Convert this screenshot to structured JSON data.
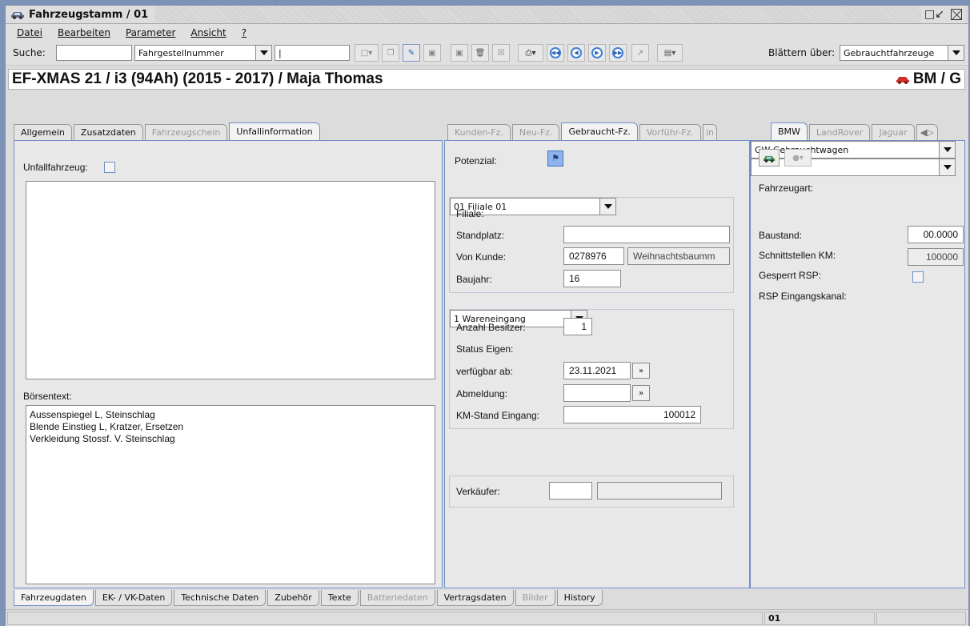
{
  "window": {
    "title": "Fahrzeugstamm / 01"
  },
  "menu": [
    "Datei",
    "Bearbeiten",
    "Parameter",
    "Ansicht",
    "?"
  ],
  "toolbar": {
    "search_label": "Suche:",
    "search_value": "",
    "search_field": "Fahrgestellnummer",
    "search_term": "|",
    "browse_label": "Blättern über:",
    "browse_value": "Gebrauchtfahrzeuge"
  },
  "header": {
    "record": "EF-XMAS 21 / i3 (94Ah) (2015 - 2017) / Maja Thomas",
    "brand_code": "BM / G"
  },
  "left_tabs": [
    {
      "label": "Allgemein",
      "state": "normal"
    },
    {
      "label": "Zusatzdaten",
      "state": "normal"
    },
    {
      "label": "Fahrzeugschein",
      "state": "disabled"
    },
    {
      "label": "Unfallinformation",
      "state": "selected"
    }
  ],
  "mid_tabs": [
    {
      "label": "Kunden-Fz.",
      "state": "disabled"
    },
    {
      "label": "Neu-Fz.",
      "state": "disabled"
    },
    {
      "label": "Gebraucht-Fz.",
      "state": "selected"
    },
    {
      "label": "Vorführ-Fz.",
      "state": "disabled"
    },
    {
      "label": "in",
      "state": "disabled"
    }
  ],
  "right_tabs": [
    {
      "label": "BMW",
      "state": "selected"
    },
    {
      "label": "LandRover",
      "state": "disabled"
    },
    {
      "label": "Jaguar",
      "state": "disabled"
    }
  ],
  "left_panel": {
    "accident_label": "Unfallfahrzeug:",
    "accident_checked": false,
    "exchange_label": "Börsentext:",
    "exchange_lines": [
      "Aussenspiegel L, Steinschlag",
      "Blende Einstieg L, Kratzer, Ersetzen",
      "Verkleidung Stossf. V. Steinschlag"
    ]
  },
  "mid_panel": {
    "potenzial_label": "Potenzial:",
    "filiale_label": "Filiale:",
    "filiale_value": "01 Filiale 01",
    "standplatz_label": "Standplatz:",
    "standplatz_value": "",
    "kunde_label": "Von Kunde:",
    "kunde_nr": "0278976",
    "kunde_name": "Weihnachtsbaumm",
    "baujahr_label": "Baujahr:",
    "baujahr_value": "16",
    "besitzer_label": "Anzahl Besitzer:",
    "besitzer_value": "1",
    "status_label": "Status Eigen:",
    "status_value": "1 Wareneingang",
    "verfuegbar_label": "verfügbar ab:",
    "verfuegbar_value": "23.11.2021",
    "abmeldung_label": "Abmeldung:",
    "abmeldung_value": "",
    "km_label": "KM-Stand Eingang:",
    "km_value": "100012",
    "verkaeufer_label": "Verkäufer:",
    "verkaeufer_code": "",
    "verkaeufer_name": ""
  },
  "right_panel": {
    "fahrzeugart_label": "Fahrzeugart:",
    "fahrzeugart_value": "GW Gebrauchtwagen",
    "baustand_label": "Baustand:",
    "baustand_value": "00.0000",
    "km_label": "Schnittstellen KM:",
    "km_value": "100000",
    "rsp_label": "Gesperrt RSP:",
    "kanal_label": "RSP Eingangskanal:",
    "kanal_value": ""
  },
  "bottom_tabs": [
    {
      "label": "Fahrzeugdaten",
      "state": "selected"
    },
    {
      "label": "EK- / VK-Daten",
      "state": "normal"
    },
    {
      "label": "Technische Daten",
      "state": "normal"
    },
    {
      "label": "Zubehör",
      "state": "normal"
    },
    {
      "label": "Texte",
      "state": "normal"
    },
    {
      "label": "Batteriedaten",
      "state": "disabled"
    },
    {
      "label": "Vertragsdaten",
      "state": "normal"
    },
    {
      "label": "Bilder",
      "state": "disabled"
    },
    {
      "label": "History",
      "state": "normal"
    }
  ],
  "status": {
    "branch": "01"
  },
  "colors": {
    "accent": "#6f8fc8",
    "car_icon": "#d0302c"
  }
}
